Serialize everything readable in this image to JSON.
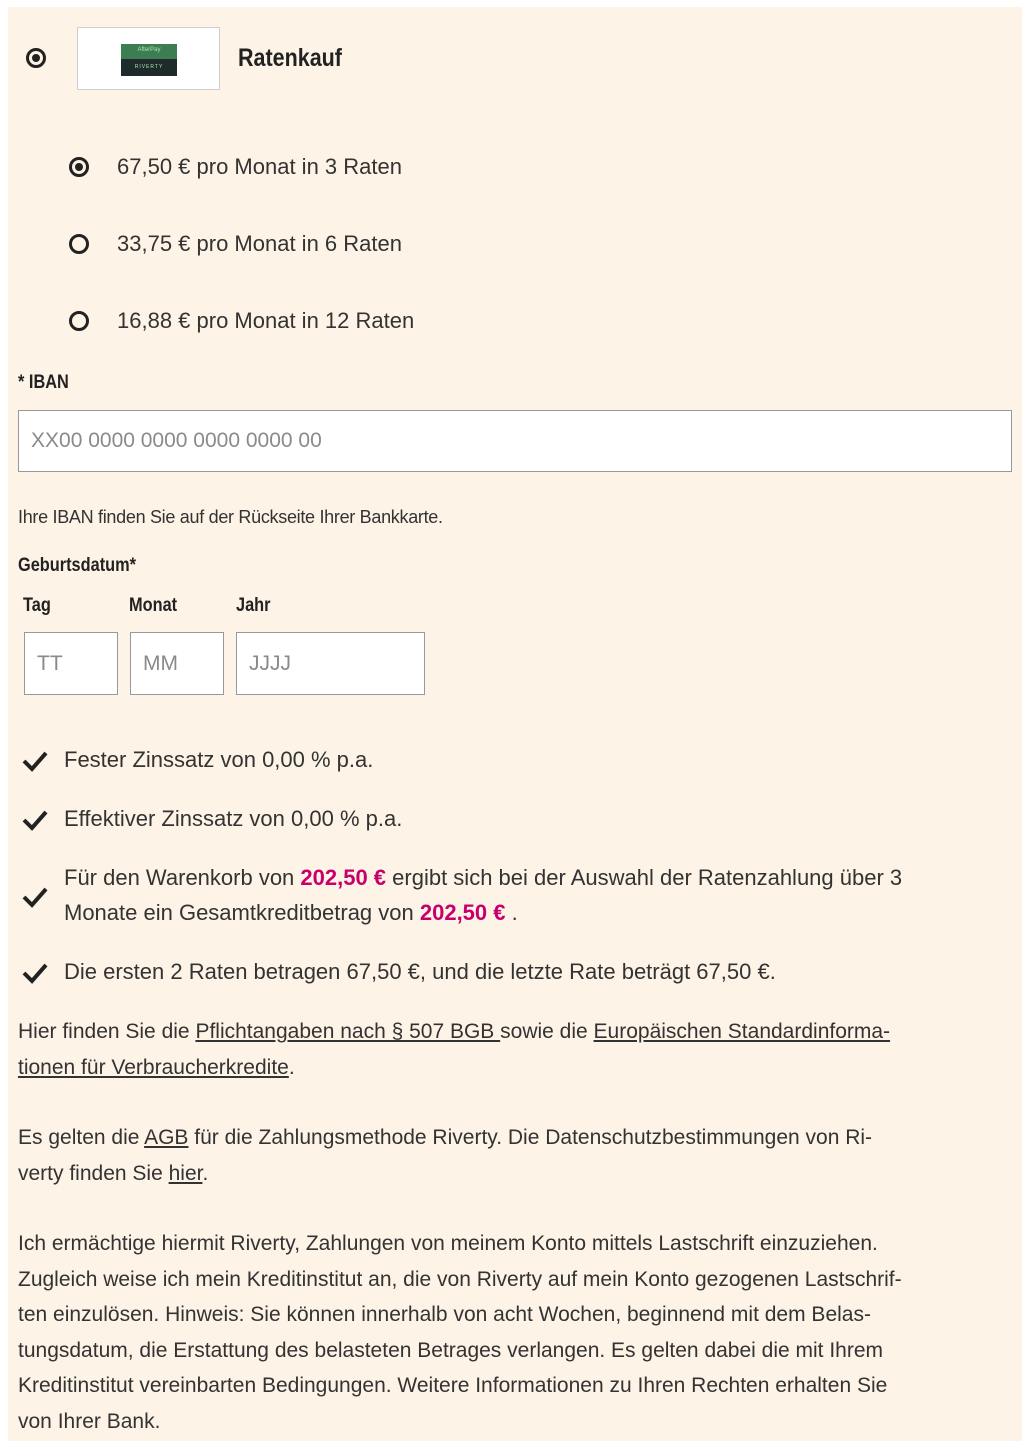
{
  "payment": {
    "method_label": "Ratenkauf",
    "logo": {
      "top": "AfterPay",
      "bottom": "RIVERTY",
      "icon": "afterpay-riverty-logo"
    }
  },
  "installments": [
    {
      "label": "67,50 € pro Monat in 3 Raten",
      "selected": true
    },
    {
      "label": "33,75 € pro Monat in 6 Raten",
      "selected": false
    },
    {
      "label": "16,88 € pro Monat in 12 Raten",
      "selected": false
    }
  ],
  "iban": {
    "label": "* IBAN",
    "placeholder": "XX00 0000 0000 0000 0000 00",
    "hint": "Ihre IBAN finden Sie auf der Rückseite Ihrer Bankkarte."
  },
  "birthdate": {
    "label": "Geburtsdatum*",
    "day": {
      "label": "Tag",
      "placeholder": "TT"
    },
    "month": {
      "label": "Monat",
      "placeholder": "MM"
    },
    "year": {
      "label": "Jahr",
      "placeholder": "JJJJ"
    }
  },
  "features": {
    "fixed_rate": "Fester Zinssatz von 0,00 % p.a.",
    "effective_rate": "Effektiver Zinssatz von 0,00 % p.a.",
    "basket": {
      "prefix": "Für den Warenkorb von ",
      "amount": "202,50 €",
      "middle_line1": " ergibt sich bei der Auswahl der Ratenzahlung über 3",
      "middle_line2": "Monate ein Gesamtkreditbetrag von ",
      "total": "202,50 €",
      "suffix": " ."
    },
    "rates_note": "Die ersten 2 Raten betragen 67,50 €, und die letzte Rate beträgt 67,50 €."
  },
  "legal": {
    "p1": {
      "prefix": "Hier finden Sie die ",
      "link1": "Pflichtangaben nach § 507 BGB ",
      "middle": "sowie die ",
      "link2_line1": "Europäischen Standardinforma-",
      "link2_line2": "tionen für Verbraucherkredite",
      "suffix": "."
    },
    "p2": {
      "prefix": "Es gelten die ",
      "link_agb": "AGB",
      "middle_line1": " für die Zahlungsmethode Riverty. Die Datenschutzbestimmungen von Ri-",
      "middle_line2": "verty finden Sie ",
      "link_hier": "hier",
      "suffix": "."
    },
    "p3_lines": [
      "Ich ermächtige hiermit Riverty, Zahlungen von meinem Konto mittels Lastschrift einzuziehen.",
      "Zugleich weise ich mein Kreditinstitut an, die von Riverty auf mein Konto gezogenen Lastschrif-",
      "ten einzulösen. Hinweis: Sie können innerhalb von acht Wochen, beginnend mit dem Belas-",
      "tungsdatum, die Erstattung des belasteten Betrages verlangen. Es gelten dabei die mit Ihrem",
      "Kreditinstitut vereinbarten Bedingungen. Weitere Informationen zu Ihren Rechten erhalten Sie",
      "von Ihrer Bank."
    ]
  },
  "colors": {
    "panel_bg": "#fdf3e6",
    "highlight": "#c8006b",
    "logo_bg": "#1f2a2a",
    "logo_accent": "#a8e6b0"
  }
}
